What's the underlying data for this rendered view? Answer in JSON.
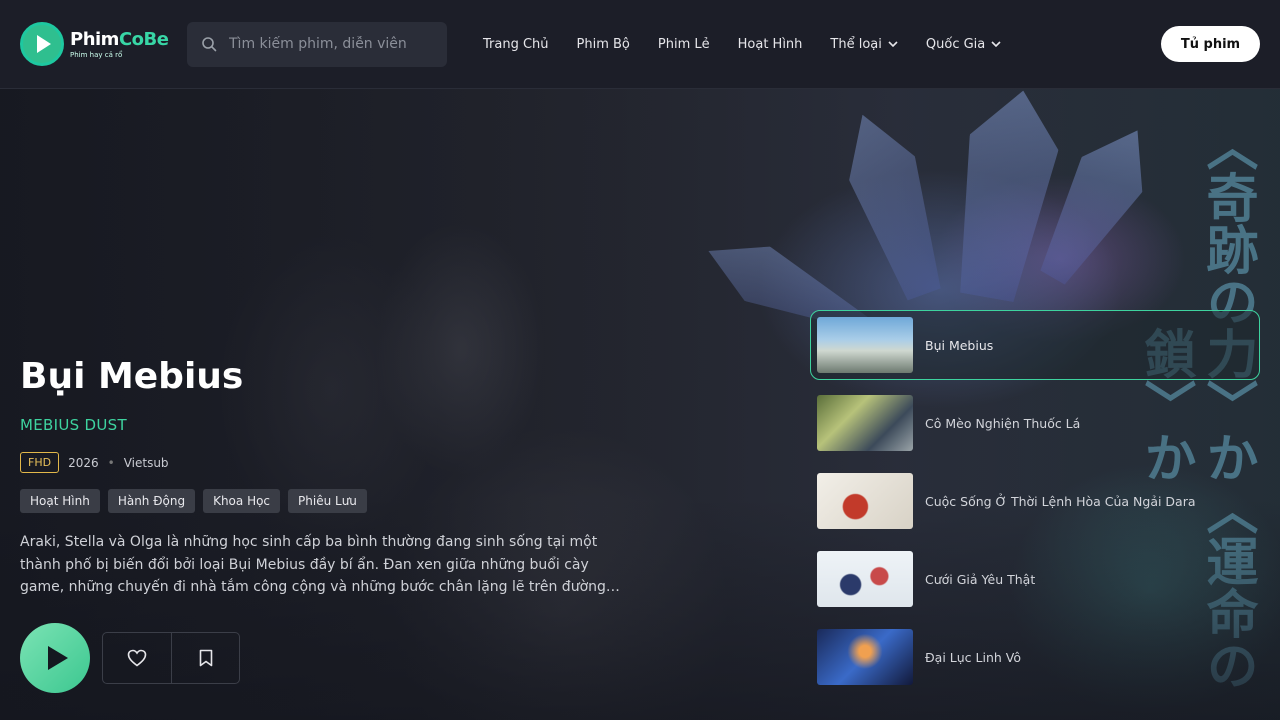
{
  "header": {
    "logo": {
      "name_main": "Phim",
      "name_accent": "CoBe",
      "tagline": "Phim hay cả rổ"
    },
    "search": {
      "placeholder": "Tìm kiếm phim, diễn viên"
    },
    "nav": [
      {
        "label": "Trang Chủ",
        "dropdown": false
      },
      {
        "label": "Phim Bộ",
        "dropdown": false
      },
      {
        "label": "Phim Lẻ",
        "dropdown": false
      },
      {
        "label": "Hoạt Hình",
        "dropdown": false
      },
      {
        "label": "Thể loại",
        "dropdown": true
      },
      {
        "label": "Quốc Gia",
        "dropdown": true
      }
    ],
    "library_button": "Tủ phim"
  },
  "hero": {
    "title": "Bụi Mebius",
    "original_title": "MEBIUS DUST",
    "quality": "FHD",
    "year": "2026",
    "separator": "•",
    "language": "Vietsub",
    "genres": [
      "Hoạt Hình",
      "Hành Động",
      "Khoa Học",
      "Phiêu Lưu"
    ],
    "description": "Araki, Stella và Olga là những học sinh cấp ba bình thường đang sinh sống tại một thành phố bị biến đổi bởi loại Bụi Mebius đầy bí ẩn. Đan xen giữa những buổi cày game, những chuyến đi nhà tắm công cộng và những bước chân lặng lẽ trên đường…",
    "background_text": "〈奇跡の力〉か〈運命の鎖〉か"
  },
  "side_list": [
    {
      "title": "Bụi Mebius",
      "active": true
    },
    {
      "title": "Cô Mèo Nghiện Thuốc Lá",
      "active": false
    },
    {
      "title": "Cuộc Sống Ở Thời Lệnh Hòa Của Ngải Dara",
      "active": false
    },
    {
      "title": "Cưới Giả Yêu Thật",
      "active": false
    },
    {
      "title": "Đại Lục Linh Vô",
      "active": false
    }
  ],
  "colors": {
    "accent": "#3ed39f",
    "quality_border": "#e2b84a",
    "background": "#1b1d27"
  },
  "icons": [
    "search-icon",
    "chevron-down-icon",
    "play-icon",
    "heart-icon",
    "bookmark-icon"
  ]
}
